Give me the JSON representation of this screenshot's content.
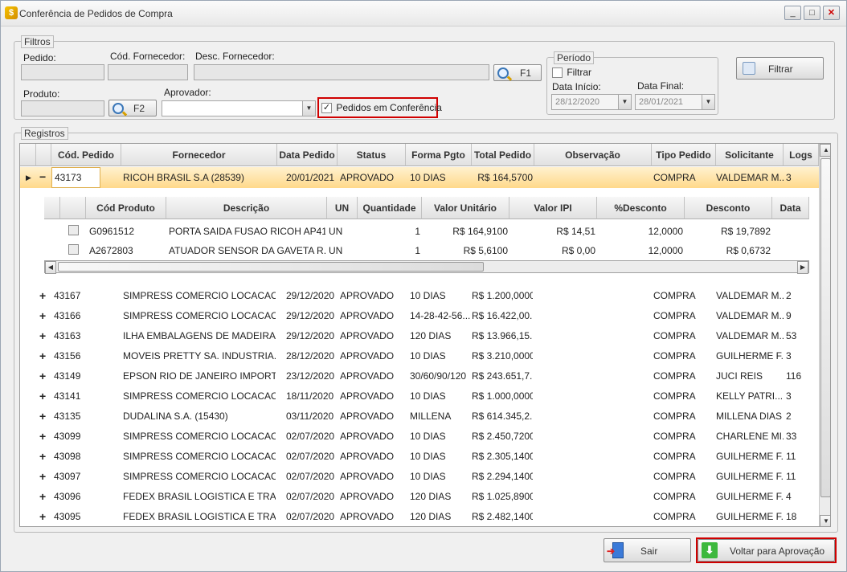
{
  "window": {
    "title": "Conferência de Pedidos de Compra"
  },
  "filtros": {
    "legend": "Filtros",
    "pedido_label": "Pedido:",
    "cod_fornecedor_label": "Cód. Fornecedor:",
    "desc_fornecedor_label": "Desc. Fornecedor:",
    "f1_label": "F1",
    "produto_label": "Produto:",
    "f2_label": "F2",
    "aprovador_label": "Aprovador:",
    "pedidos_conferencia_label": "Pedidos em Conferência",
    "pedidos_conferencia_checked": true
  },
  "periodo": {
    "legend": "Período",
    "filtrar_label": "Filtrar",
    "data_inicio_label": "Data Início:",
    "data_inicio_value": "28/12/2020",
    "data_final_label": "Data Final:",
    "data_final_value": "28/01/2021"
  },
  "filtrar_button": "Filtrar",
  "registros": {
    "legend": "Registros",
    "columns": [
      "Cód. Pedido",
      "Fornecedor",
      "Data Pedido",
      "Status",
      "Forma Pgto",
      "Total Pedido",
      "Observação",
      "Tipo Pedido",
      "Solicitante",
      "Logs"
    ],
    "expanded_row": {
      "cod": "43173",
      "fornecedor": "RICOH BRASIL S.A  (28539)",
      "data": "20/01/2021",
      "status": "APROVADO",
      "forma": "10 DIAS",
      "total": "R$ 164,5700",
      "obs": "",
      "tipo": "COMPRA",
      "solicitante": "VALDEMAR  M...",
      "logs": "3"
    },
    "sub_columns": [
      "Cód Produto",
      "Descrição",
      "UN",
      "Quantidade",
      "Valor Unitário",
      "Valor IPI",
      "%Desconto",
      "Desconto",
      "Data"
    ],
    "sub_rows": [
      {
        "cod": "G0961512",
        "desc": "PORTA SAIDA FUSAO RICOH AP41...",
        "un": "UN",
        "qtd": "1",
        "vunit": "R$ 164,9100",
        "ipi": "R$ 14,51",
        "pdesc": "12,0000",
        "desconto": "R$ 19,7892"
      },
      {
        "cod": "A2672803",
        "desc": "ATUADOR SENSOR DA GAVETA  R...",
        "un": "UN",
        "qtd": "1",
        "vunit": "R$ 5,6100",
        "ipi": "R$ 0,00",
        "pdesc": "12,0000",
        "desconto": "R$ 0,6732"
      }
    ],
    "rows": [
      {
        "cod": "43167",
        "fornecedor": "SIMPRESS  COMERCIO  LOCACAO...",
        "data": "29/12/2020",
        "status": "APROVADO",
        "forma": "10 DIAS",
        "total": "R$ 1.200,0000",
        "tipo": "COMPRA",
        "solicitante": "VALDEMAR  M...",
        "logs": "2"
      },
      {
        "cod": "43166",
        "fornecedor": "SIMPRESS  COMERCIO  LOCACAO...",
        "data": "29/12/2020",
        "status": "APROVADO",
        "forma": "14-28-42-56...",
        "total": "R$ 16.422,00...",
        "tipo": "COMPRA",
        "solicitante": "VALDEMAR  M...",
        "logs": "9"
      },
      {
        "cod": "43163",
        "fornecedor": "ILHA  EMBALAGENS  DE  MADEIRA...",
        "data": "29/12/2020",
        "status": "APROVADO",
        "forma": "120 DIAS",
        "total": "R$ 13.966,15...",
        "tipo": "COMPRA",
        "solicitante": "VALDEMAR  M...",
        "logs": "53"
      },
      {
        "cod": "43156",
        "fornecedor": "MOVEIS  PRETTY  SA.  INDUSTRIA...",
        "data": "28/12/2020",
        "status": "APROVADO",
        "forma": "10 DIAS",
        "total": "R$ 3.210,0000",
        "tipo": "COMPRA",
        "solicitante": "GUILHERME  F...",
        "logs": "3"
      },
      {
        "cod": "43149",
        "fornecedor": "EPSON  RIO  DE  JANEIRO  IMPORT...",
        "data": "23/12/2020",
        "status": "APROVADO",
        "forma": "30/60/90/120",
        "total": "R$ 243.651,7...",
        "tipo": "COMPRA",
        "solicitante": "JUCI REIS",
        "logs": "116"
      },
      {
        "cod": "43141",
        "fornecedor": "SIMPRESS  COMERCIO  LOCACAO...",
        "data": "18/11/2020",
        "status": "APROVADO",
        "forma": "10 DIAS",
        "total": "R$ 1.000,0000",
        "tipo": "COMPRA",
        "solicitante": "KELLY  PATRI...",
        "logs": "3"
      },
      {
        "cod": "43135",
        "fornecedor": "DUDALINA S.A. (15430)",
        "data": "03/11/2020",
        "status": "APROVADO",
        "forma": "MILLENA",
        "total": "R$ 614.345,2...",
        "tipo": "COMPRA",
        "solicitante": "MILLENA DIAS",
        "logs": "2"
      },
      {
        "cod": "43099",
        "fornecedor": "SIMPRESS  COMERCIO  LOCACAO...",
        "data": "02/07/2020",
        "status": "APROVADO",
        "forma": "10 DIAS",
        "total": "R$ 2.450,7200",
        "tipo": "COMPRA",
        "solicitante": "CHARLENE  MI...",
        "logs": "33"
      },
      {
        "cod": "43098",
        "fornecedor": "SIMPRESS  COMERCIO  LOCACAO...",
        "data": "02/07/2020",
        "status": "APROVADO",
        "forma": "10 DIAS",
        "total": "R$ 2.305,1400",
        "tipo": "COMPRA",
        "solicitante": "GUILHERME  F...",
        "logs": "11"
      },
      {
        "cod": "43097",
        "fornecedor": "SIMPRESS  COMERCIO  LOCACAO...",
        "data": "02/07/2020",
        "status": "APROVADO",
        "forma": "10 DIAS",
        "total": "R$ 2.294,1400",
        "tipo": "COMPRA",
        "solicitante": "GUILHERME  F...",
        "logs": "11"
      },
      {
        "cod": "43096",
        "fornecedor": "FEDEX  BRASIL  LOGISTICA  E  TRA...",
        "data": "02/07/2020",
        "status": "APROVADO",
        "forma": "120 DIAS",
        "total": "R$ 1.025,8900",
        "tipo": "COMPRA",
        "solicitante": "GUILHERME  F...",
        "logs": "4"
      },
      {
        "cod": "43095",
        "fornecedor": "FEDEX  BRASIL  LOGISTICA  E  TRA...",
        "data": "02/07/2020",
        "status": "APROVADO",
        "forma": "120 DIAS",
        "total": "R$ 2.482,1400",
        "tipo": "COMPRA",
        "solicitante": "GUILHERME  F...",
        "logs": "18"
      }
    ]
  },
  "footer": {
    "sair_label": "Sair",
    "voltar_label": "Voltar para Aprovação"
  },
  "colors": {
    "selected_row": "#ffd98a",
    "highlight_box": "#d00000"
  }
}
